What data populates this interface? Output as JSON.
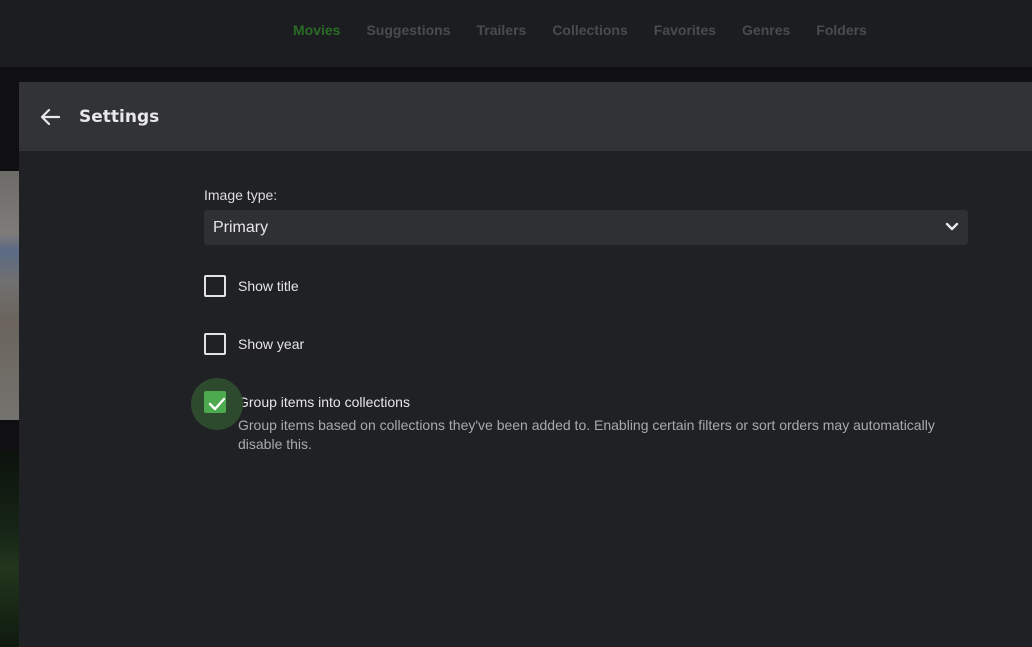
{
  "nav": {
    "tabs": [
      {
        "label": "Movies",
        "active": true
      },
      {
        "label": "Suggestions",
        "active": false
      },
      {
        "label": "Trailers",
        "active": false
      },
      {
        "label": "Collections",
        "active": false
      },
      {
        "label": "Favorites",
        "active": false
      },
      {
        "label": "Genres",
        "active": false
      },
      {
        "label": "Folders",
        "active": false
      }
    ],
    "active_color": "#2a6b26"
  },
  "dialog": {
    "title": "Settings",
    "back_icon": "arrow-left-icon",
    "image_type": {
      "label": "Image type:",
      "value": "Primary",
      "icon": "chevron-down-icon"
    },
    "options": [
      {
        "label": "Show title",
        "checked": false
      },
      {
        "label": "Show year",
        "checked": false
      },
      {
        "label": "Group items into collections",
        "checked": true,
        "description": "Group items based on collections they've been added to. Enabling certain filters or sort orders may automatically disable this."
      }
    ],
    "accent_color": "#4eaa4e"
  }
}
